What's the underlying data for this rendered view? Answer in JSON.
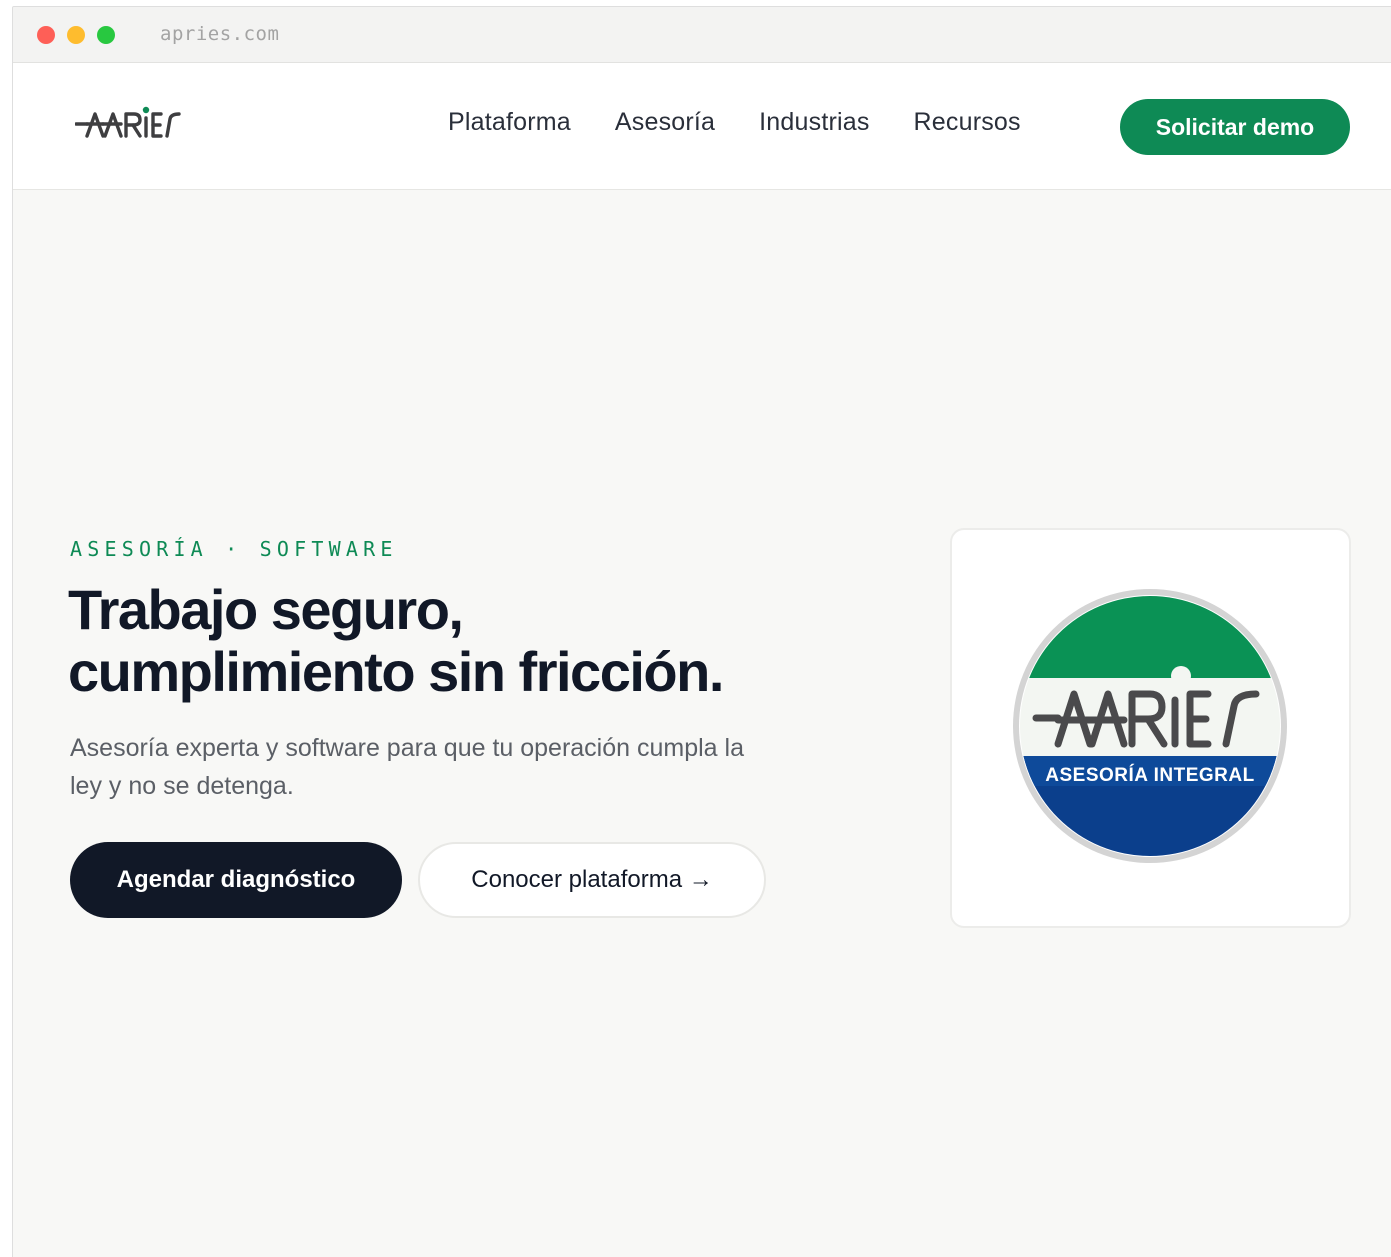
{
  "browser": {
    "url": "apries.com"
  },
  "nav": {
    "logo_text": "APRIES",
    "links": [
      "Plataforma",
      "Asesoría",
      "Industrias",
      "Recursos"
    ],
    "cta_label": "Solicitar demo"
  },
  "hero": {
    "eyebrow": "ASESORÍA · SOFTWARE",
    "headline_line1": "Trabajo seguro,",
    "headline_line2": "cumplimiento sin fricción.",
    "subtitle": "Asesoría experta y software para que tu operación cumpla la ley y no se detenga.",
    "primary_label": "Agendar diagnóstico",
    "secondary_label": "Conocer plataforma →"
  },
  "badge": {
    "logo_text": "APRIES",
    "tagline": "ASESORÍA INTEGRAL"
  },
  "colors": {
    "brand_green": "#0e8a55",
    "ink": "#111827",
    "badge_blue": "#0b3f8c",
    "badge_green": "#0a9255"
  }
}
